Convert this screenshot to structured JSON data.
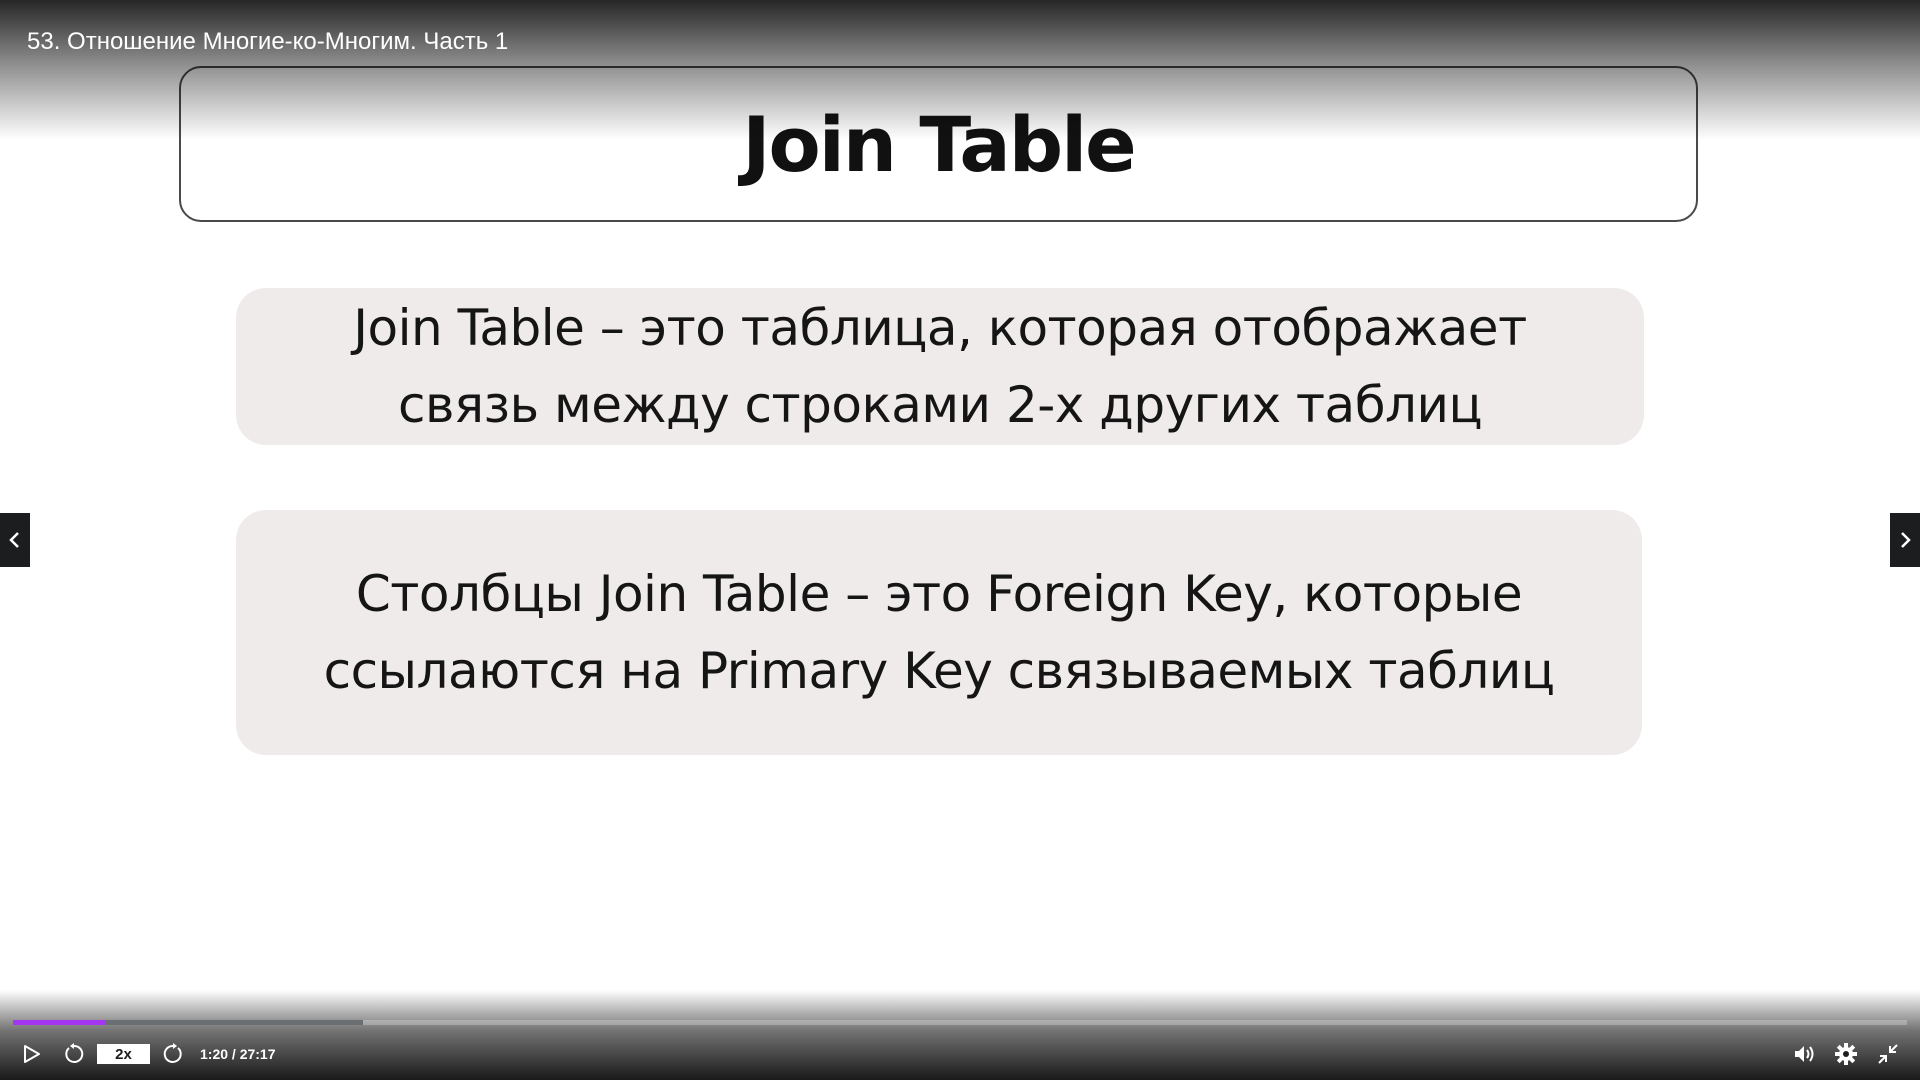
{
  "video": {
    "title": "53. Отношение Многие-ко-Многим. Часть 1"
  },
  "slide": {
    "heading": "Join Table",
    "paragraph1": "Join Table – это таблица, которая отображает связь между строками 2-х других таблиц",
    "paragraph2": "Столбцы Join Table – это Foreign Key, которые ссылаются на Primary Key связываемых таблиц"
  },
  "controls": {
    "speed_label": "2x",
    "time_display": "1:20 / 27:17",
    "progress_played_fraction": 0.049,
    "progress_buffered_fraction": 0.185
  },
  "colors": {
    "accent": "#a435f0",
    "control_bar_bg": "#1c1d1f",
    "slide_box_bg": "#efebeb"
  },
  "icons": {
    "play": "play-icon",
    "rewind": "rewind-5-icon",
    "forward": "forward-5-icon",
    "volume": "volume-icon",
    "settings": "gear-icon",
    "fullscreen": "exit-fullscreen-icon",
    "prev": "chevron-left-icon",
    "next": "chevron-right-icon"
  }
}
